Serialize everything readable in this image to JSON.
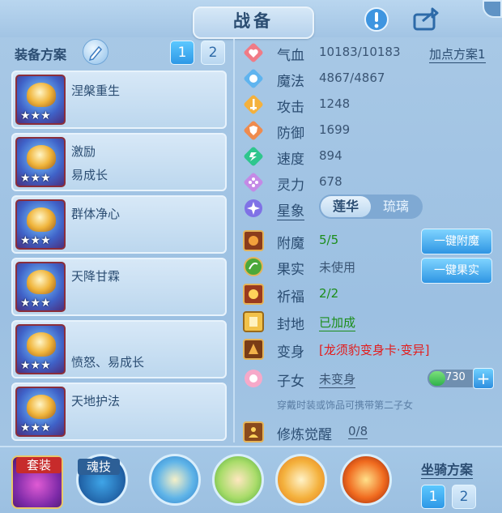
{
  "header": {
    "title": "战备"
  },
  "left": {
    "heading": "装备方案",
    "plan_buttons": [
      "1",
      "2"
    ],
    "equipment": [
      {
        "name": "涅槃重生",
        "sub": "",
        "stars": "★★★"
      },
      {
        "name": "激励",
        "sub": "易成长",
        "stars": "★★★"
      },
      {
        "name": "群体净心",
        "sub": "",
        "stars": "★★★"
      },
      {
        "name": "天降甘霖",
        "sub": "",
        "stars": "★★★"
      },
      {
        "name": "",
        "sub": "愤怒、易成长",
        "stars": "★★★"
      },
      {
        "name": "天地护法",
        "sub": "",
        "stars": "★★★"
      }
    ]
  },
  "stats": {
    "plan_link": "加点方案1",
    "rows": [
      {
        "label": "气血",
        "value": "10183/10183"
      },
      {
        "label": "魔法",
        "value": "4867/4867"
      },
      {
        "label": "攻击",
        "value": "1248"
      },
      {
        "label": "防御",
        "value": "1699"
      },
      {
        "label": "速度",
        "value": "894"
      },
      {
        "label": "灵力",
        "value": "678"
      }
    ],
    "xingxiang": {
      "label": "星象",
      "opt1": "莲华",
      "opt2": "琉璃"
    },
    "extra": [
      {
        "label": "附魔",
        "value": "5/5",
        "button": "一键附魔"
      },
      {
        "label": "果实",
        "value": "未使用",
        "button": "一键果实"
      },
      {
        "label": "祈福",
        "value": "2/2"
      },
      {
        "label": "封地",
        "value": "已加成"
      },
      {
        "label": "变身",
        "value": "[龙须豹变身卡·变异]"
      },
      {
        "label": "子女",
        "value": "未变身",
        "pill_value": "730"
      },
      {
        "label": "修炼觉醒",
        "value": "0/8"
      }
    ],
    "hint": "穿戴时装或饰品可携带第二子女"
  },
  "bottom": {
    "set_label": "套装",
    "soul_label": "魂技",
    "mount_label": "坐骑方案",
    "mount_buttons": [
      "1",
      "2"
    ]
  },
  "colors": {
    "accent": "#2e98e6",
    "green": "#1b8d1a",
    "red": "#e31c1c"
  }
}
